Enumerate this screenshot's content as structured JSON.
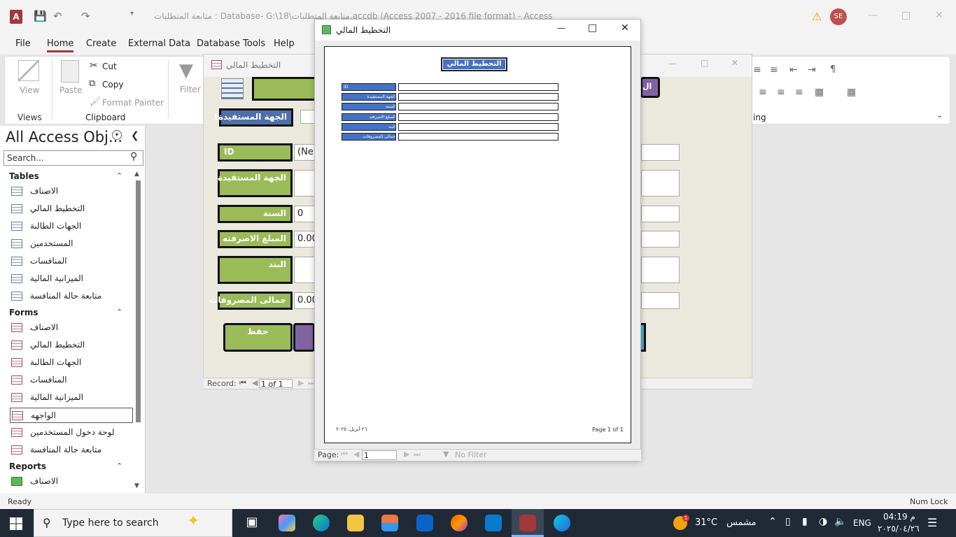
{
  "app": {
    "title": "متابعة المتطلبات : Database- G:\\18\\متابعة المتطلبات.accdb (Access 2007 - 2016 file format) - Access",
    "avatar": "SE",
    "logo": "A"
  },
  "menu": [
    "File",
    "Home",
    "Create",
    "External Data",
    "Database Tools",
    "Help"
  ],
  "ribbon": {
    "view": "View",
    "views_group": "Views",
    "paste": "Paste",
    "cut": "Cut",
    "copy": "Copy",
    "format_painter": "Format Painter",
    "clipboard_group": "Clipboard",
    "filter": "Filter",
    "formatting_group_partial": "ing"
  },
  "nav": {
    "title": "All Access Obj...",
    "search_placeholder": "Search...",
    "sections": [
      {
        "name": "Tables",
        "items": [
          "الاصناف",
          "التخطيط المالي",
          "الجهات الطالبة",
          "المستخدمين",
          "المنافسات",
          "الميزانية المالية",
          "متابعة حالة المنافسة"
        ]
      },
      {
        "name": "Forms",
        "items": [
          "الاصناف",
          "التخطيط المالي",
          "الجهات الطالبة",
          "المنافسات",
          "الميزانية المالية",
          "الواجهه",
          "لوحة دخول المستخدمين",
          "متابعة حالة المنافسة"
        ]
      },
      {
        "name": "Reports",
        "items": [
          "الاصناف"
        ]
      }
    ],
    "selected": "الواجهه"
  },
  "form_window": {
    "title": "التخطيط المالي",
    "labels": [
      "الجهة المستفيدة١",
      "ID",
      "الجهة المستفيدة",
      "السنة",
      "المبلغ الاصرفته",
      "البند",
      "جمالى المصروفات"
    ],
    "values": {
      "id": "(Ne",
      "year": "0",
      "amount": "0.00",
      "total": "0.00"
    },
    "save": "حفظ",
    "top_right_btn": "ال",
    "record_label": "Record:",
    "record_value": "1 of 1"
  },
  "report_window": {
    "title": "التخطيط المالي",
    "report_title": "التخطيط المالي",
    "labels": [
      "ID",
      "الجهة المستفيدة",
      "السنة",
      "المبلغ الاصرفته",
      "البند",
      "جمالى المصروفات"
    ],
    "footer_date": "٢٦ أبريل، ٢٠٢٥",
    "footer_page": "Page 1 of 1",
    "page_label": "Page:",
    "page_value": "1",
    "no_filter": "No Filter"
  },
  "status": {
    "left": "Ready",
    "right": "Num Lock"
  },
  "taskbar": {
    "search": "Type here to search",
    "temp": "31°C",
    "weather": "مشمس",
    "badge": "1",
    "lang": "ENG",
    "time": "04:19 م",
    "date": "٢٠٢٥/٠٤/٢٦"
  },
  "colors": {
    "access_red": "#a4373a",
    "label_green": "#9bbb59",
    "report_blue": "#4472c4",
    "button_purple": "#8064a2"
  }
}
